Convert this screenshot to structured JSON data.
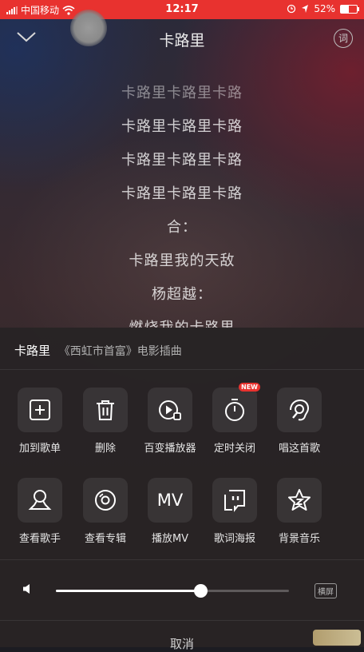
{
  "status_bar": {
    "carrier": "中国移动",
    "time": "12:17",
    "battery": "52%",
    "battery_level": 0.52
  },
  "header": {
    "title": "卡路里",
    "lyric_button_label": "词"
  },
  "lyrics": [
    "卡路里卡路里卡路",
    "卡路里卡路里卡路",
    "卡路里卡路里卡路",
    "卡路里卡路里卡路",
    "合：",
    "卡路里我的天敌",
    "杨超越：",
    "燃烧我的卡路里"
  ],
  "sheet": {
    "song_name": "卡路里",
    "song_source": "《西虹市首富》电影插曲",
    "actions_row1": [
      {
        "label": "加到歌单",
        "icon": "add-to-playlist-icon"
      },
      {
        "label": "删除",
        "icon": "trash-icon"
      },
      {
        "label": "百变播放器",
        "icon": "player-skin-icon"
      },
      {
        "label": "定时关闭",
        "icon": "timer-icon",
        "badge": "NEW"
      },
      {
        "label": "唱这首歌",
        "icon": "sing-icon"
      }
    ],
    "actions_row2": [
      {
        "label": "查看歌手",
        "icon": "singer-icon"
      },
      {
        "label": "查看专辑",
        "icon": "album-icon"
      },
      {
        "label": "播放MV",
        "icon": "mv-icon",
        "icon_text": "MV"
      },
      {
        "label": "歌词海报",
        "icon": "lyric-poster-icon"
      },
      {
        "label": "背景音乐",
        "icon": "background-music-icon"
      }
    ],
    "volume": 0.62,
    "landscape_label": "横屏",
    "cancel_label": "取消"
  }
}
